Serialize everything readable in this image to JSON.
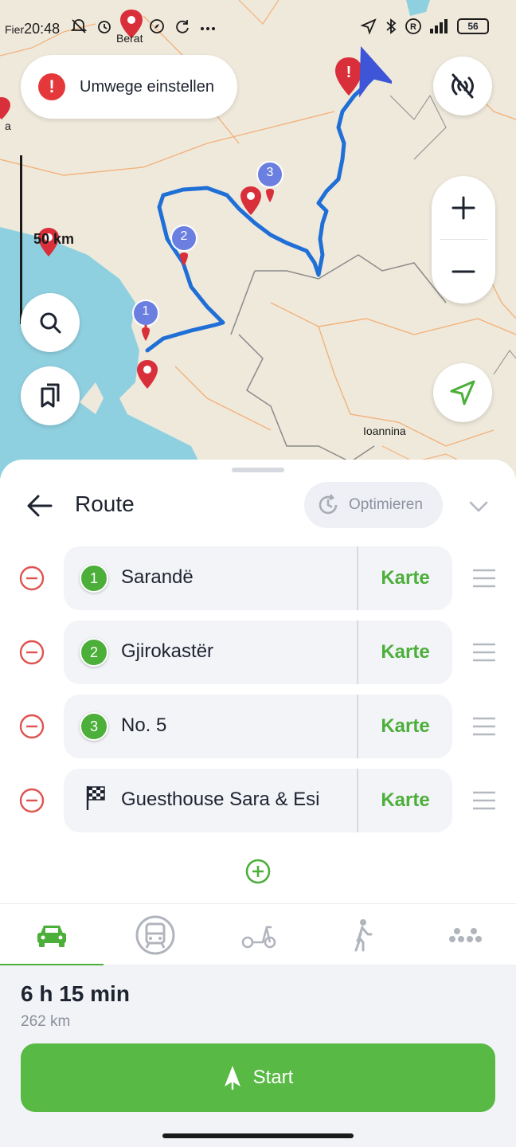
{
  "statusbar": {
    "left_label": "Fier",
    "time": "20:48",
    "battery": "56"
  },
  "map": {
    "detour_label": "Umwege einstellen",
    "scale_label": "50 km",
    "city_berat": "Berat",
    "city_ioannina": "Ioannina",
    "city_partial": "a",
    "waypoint_labels": [
      "1",
      "2",
      "3"
    ]
  },
  "route": {
    "title": "Route",
    "optimize_label": "Optimieren",
    "map_label": "Karte",
    "stops": [
      {
        "badge": "1",
        "name": "Sarandë"
      },
      {
        "badge": "2",
        "name": "Gjirokastër"
      },
      {
        "badge": "3",
        "name": "No. 5"
      },
      {
        "badge": "",
        "name": "Guesthouse Sara & Esi"
      }
    ]
  },
  "modes": [
    "car-icon",
    "transit-icon",
    "scooter-icon",
    "walk-icon",
    "more-icon"
  ],
  "summary": {
    "duration": "6 h 15 min",
    "distance": "262 km",
    "start_label": "Start"
  },
  "colors": {
    "accent": "#58b944",
    "route": "#1f6fd6",
    "pin_red": "#d92f3a",
    "waypoint_blue": "#6a7fe0",
    "sea": "#8fd0e0"
  }
}
